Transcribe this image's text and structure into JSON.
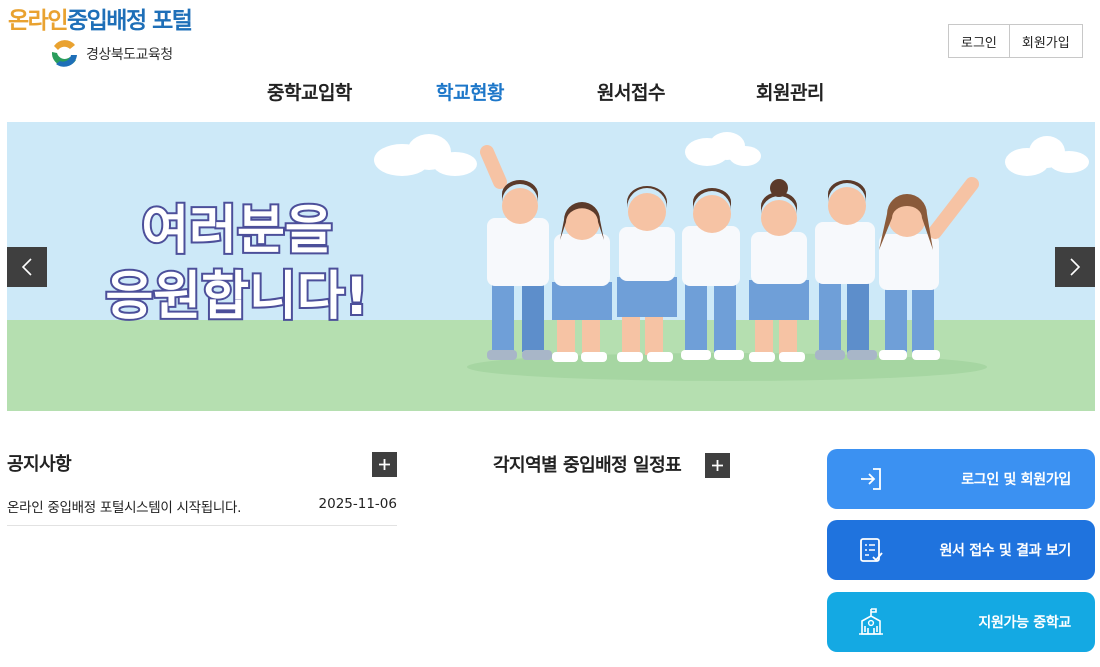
{
  "header": {
    "logo_title_part1": "온라인",
    "logo_title_part2": "중입배정 포털",
    "logo_office": "경상북도교육청",
    "auth": {
      "login": "로그인",
      "signup": "회원가입"
    }
  },
  "nav": {
    "items": [
      {
        "label": "중학교입학"
      },
      {
        "label": "학교현황",
        "active": true
      },
      {
        "label": "원서접수"
      },
      {
        "label": "회원관리"
      }
    ],
    "active_color": "#1d77c9"
  },
  "banner": {
    "line1": "여러분을",
    "line2": "응원합니다!",
    "prev_icon": "chevron-left-icon",
    "next_icon": "chevron-right-icon"
  },
  "notice": {
    "title": "공지사항",
    "more_icon": "plus-icon",
    "items": [
      {
        "title": "온라인 중입배정 포털시스템이 시작됩니다.",
        "date": "2025-11-06"
      }
    ]
  },
  "schedule": {
    "title": "각지역별 중입배정 일정표",
    "more_icon": "plus-icon"
  },
  "quick_links": [
    {
      "label": "로그인 및 회원가입",
      "icon": "login-icon",
      "color": "#3b91f2"
    },
    {
      "label": "원서 접수 및 결과 보기",
      "icon": "document-check-icon",
      "color": "#1f73de"
    },
    {
      "label": "지원가능 중학교",
      "icon": "school-icon",
      "color": "#14a9e3"
    }
  ]
}
